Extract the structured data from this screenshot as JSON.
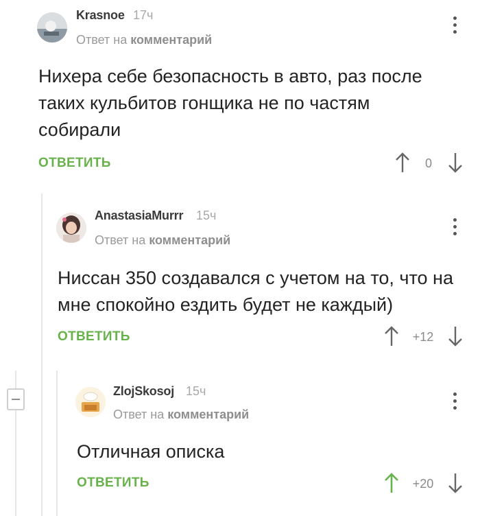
{
  "reply_to_prefix": "Ответ на",
  "reply_to_target": "комментарий",
  "reply_label": "ОТВЕТИТЬ",
  "colors": {
    "accent_green": "#67b24a",
    "upvoted_green": "#67b24a",
    "neutral_arrow": "#666666"
  },
  "comments": [
    {
      "username": "Krasnoe",
      "time": "17ч",
      "text": "Нихера себе безопасность в авто, раз после таких кульбитов гонщика не по частям собирали",
      "rating": "0",
      "upvoted": false
    },
    {
      "username": "AnastasiaMurrr",
      "time": "15ч",
      "text": "Ниссан 350 создавался с учетом на то, что на мне спокойно ездить будет не каждый)",
      "rating": "+12",
      "upvoted": false
    },
    {
      "username": "ZlojSkosoj",
      "time": "15ч",
      "text": "Отличная описка",
      "rating": "+20",
      "upvoted": true
    }
  ]
}
